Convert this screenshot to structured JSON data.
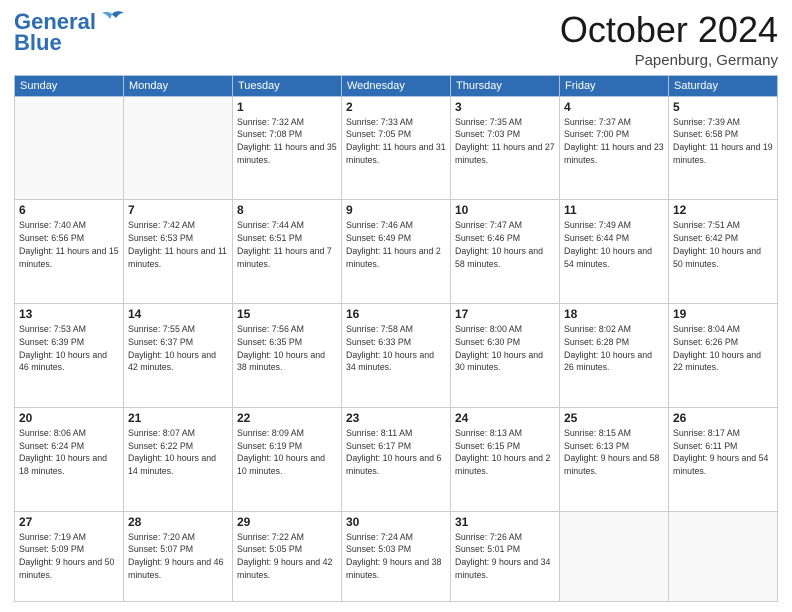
{
  "header": {
    "logo_line1": "General",
    "logo_line2": "Blue",
    "month": "October 2024",
    "location": "Papenburg, Germany"
  },
  "weekdays": [
    "Sunday",
    "Monday",
    "Tuesday",
    "Wednesday",
    "Thursday",
    "Friday",
    "Saturday"
  ],
  "weeks": [
    [
      {
        "day": null
      },
      {
        "day": null
      },
      {
        "day": "1",
        "sunrise": "7:32 AM",
        "sunset": "7:08 PM",
        "daylight": "11 hours and 35 minutes."
      },
      {
        "day": "2",
        "sunrise": "7:33 AM",
        "sunset": "7:05 PM",
        "daylight": "11 hours and 31 minutes."
      },
      {
        "day": "3",
        "sunrise": "7:35 AM",
        "sunset": "7:03 PM",
        "daylight": "11 hours and 27 minutes."
      },
      {
        "day": "4",
        "sunrise": "7:37 AM",
        "sunset": "7:00 PM",
        "daylight": "11 hours and 23 minutes."
      },
      {
        "day": "5",
        "sunrise": "7:39 AM",
        "sunset": "6:58 PM",
        "daylight": "11 hours and 19 minutes."
      }
    ],
    [
      {
        "day": "6",
        "sunrise": "7:40 AM",
        "sunset": "6:56 PM",
        "daylight": "11 hours and 15 minutes."
      },
      {
        "day": "7",
        "sunrise": "7:42 AM",
        "sunset": "6:53 PM",
        "daylight": "11 hours and 11 minutes."
      },
      {
        "day": "8",
        "sunrise": "7:44 AM",
        "sunset": "6:51 PM",
        "daylight": "11 hours and 7 minutes."
      },
      {
        "day": "9",
        "sunrise": "7:46 AM",
        "sunset": "6:49 PM",
        "daylight": "11 hours and 2 minutes."
      },
      {
        "day": "10",
        "sunrise": "7:47 AM",
        "sunset": "6:46 PM",
        "daylight": "10 hours and 58 minutes."
      },
      {
        "day": "11",
        "sunrise": "7:49 AM",
        "sunset": "6:44 PM",
        "daylight": "10 hours and 54 minutes."
      },
      {
        "day": "12",
        "sunrise": "7:51 AM",
        "sunset": "6:42 PM",
        "daylight": "10 hours and 50 minutes."
      }
    ],
    [
      {
        "day": "13",
        "sunrise": "7:53 AM",
        "sunset": "6:39 PM",
        "daylight": "10 hours and 46 minutes."
      },
      {
        "day": "14",
        "sunrise": "7:55 AM",
        "sunset": "6:37 PM",
        "daylight": "10 hours and 42 minutes."
      },
      {
        "day": "15",
        "sunrise": "7:56 AM",
        "sunset": "6:35 PM",
        "daylight": "10 hours and 38 minutes."
      },
      {
        "day": "16",
        "sunrise": "7:58 AM",
        "sunset": "6:33 PM",
        "daylight": "10 hours and 34 minutes."
      },
      {
        "day": "17",
        "sunrise": "8:00 AM",
        "sunset": "6:30 PM",
        "daylight": "10 hours and 30 minutes."
      },
      {
        "day": "18",
        "sunrise": "8:02 AM",
        "sunset": "6:28 PM",
        "daylight": "10 hours and 26 minutes."
      },
      {
        "day": "19",
        "sunrise": "8:04 AM",
        "sunset": "6:26 PM",
        "daylight": "10 hours and 22 minutes."
      }
    ],
    [
      {
        "day": "20",
        "sunrise": "8:06 AM",
        "sunset": "6:24 PM",
        "daylight": "10 hours and 18 minutes."
      },
      {
        "day": "21",
        "sunrise": "8:07 AM",
        "sunset": "6:22 PM",
        "daylight": "10 hours and 14 minutes."
      },
      {
        "day": "22",
        "sunrise": "8:09 AM",
        "sunset": "6:19 PM",
        "daylight": "10 hours and 10 minutes."
      },
      {
        "day": "23",
        "sunrise": "8:11 AM",
        "sunset": "6:17 PM",
        "daylight": "10 hours and 6 minutes."
      },
      {
        "day": "24",
        "sunrise": "8:13 AM",
        "sunset": "6:15 PM",
        "daylight": "10 hours and 2 minutes."
      },
      {
        "day": "25",
        "sunrise": "8:15 AM",
        "sunset": "6:13 PM",
        "daylight": "9 hours and 58 minutes."
      },
      {
        "day": "26",
        "sunrise": "8:17 AM",
        "sunset": "6:11 PM",
        "daylight": "9 hours and 54 minutes."
      }
    ],
    [
      {
        "day": "27",
        "sunrise": "7:19 AM",
        "sunset": "5:09 PM",
        "daylight": "9 hours and 50 minutes."
      },
      {
        "day": "28",
        "sunrise": "7:20 AM",
        "sunset": "5:07 PM",
        "daylight": "9 hours and 46 minutes."
      },
      {
        "day": "29",
        "sunrise": "7:22 AM",
        "sunset": "5:05 PM",
        "daylight": "9 hours and 42 minutes."
      },
      {
        "day": "30",
        "sunrise": "7:24 AM",
        "sunset": "5:03 PM",
        "daylight": "9 hours and 38 minutes."
      },
      {
        "day": "31",
        "sunrise": "7:26 AM",
        "sunset": "5:01 PM",
        "daylight": "9 hours and 34 minutes."
      },
      {
        "day": null
      },
      {
        "day": null
      }
    ]
  ]
}
